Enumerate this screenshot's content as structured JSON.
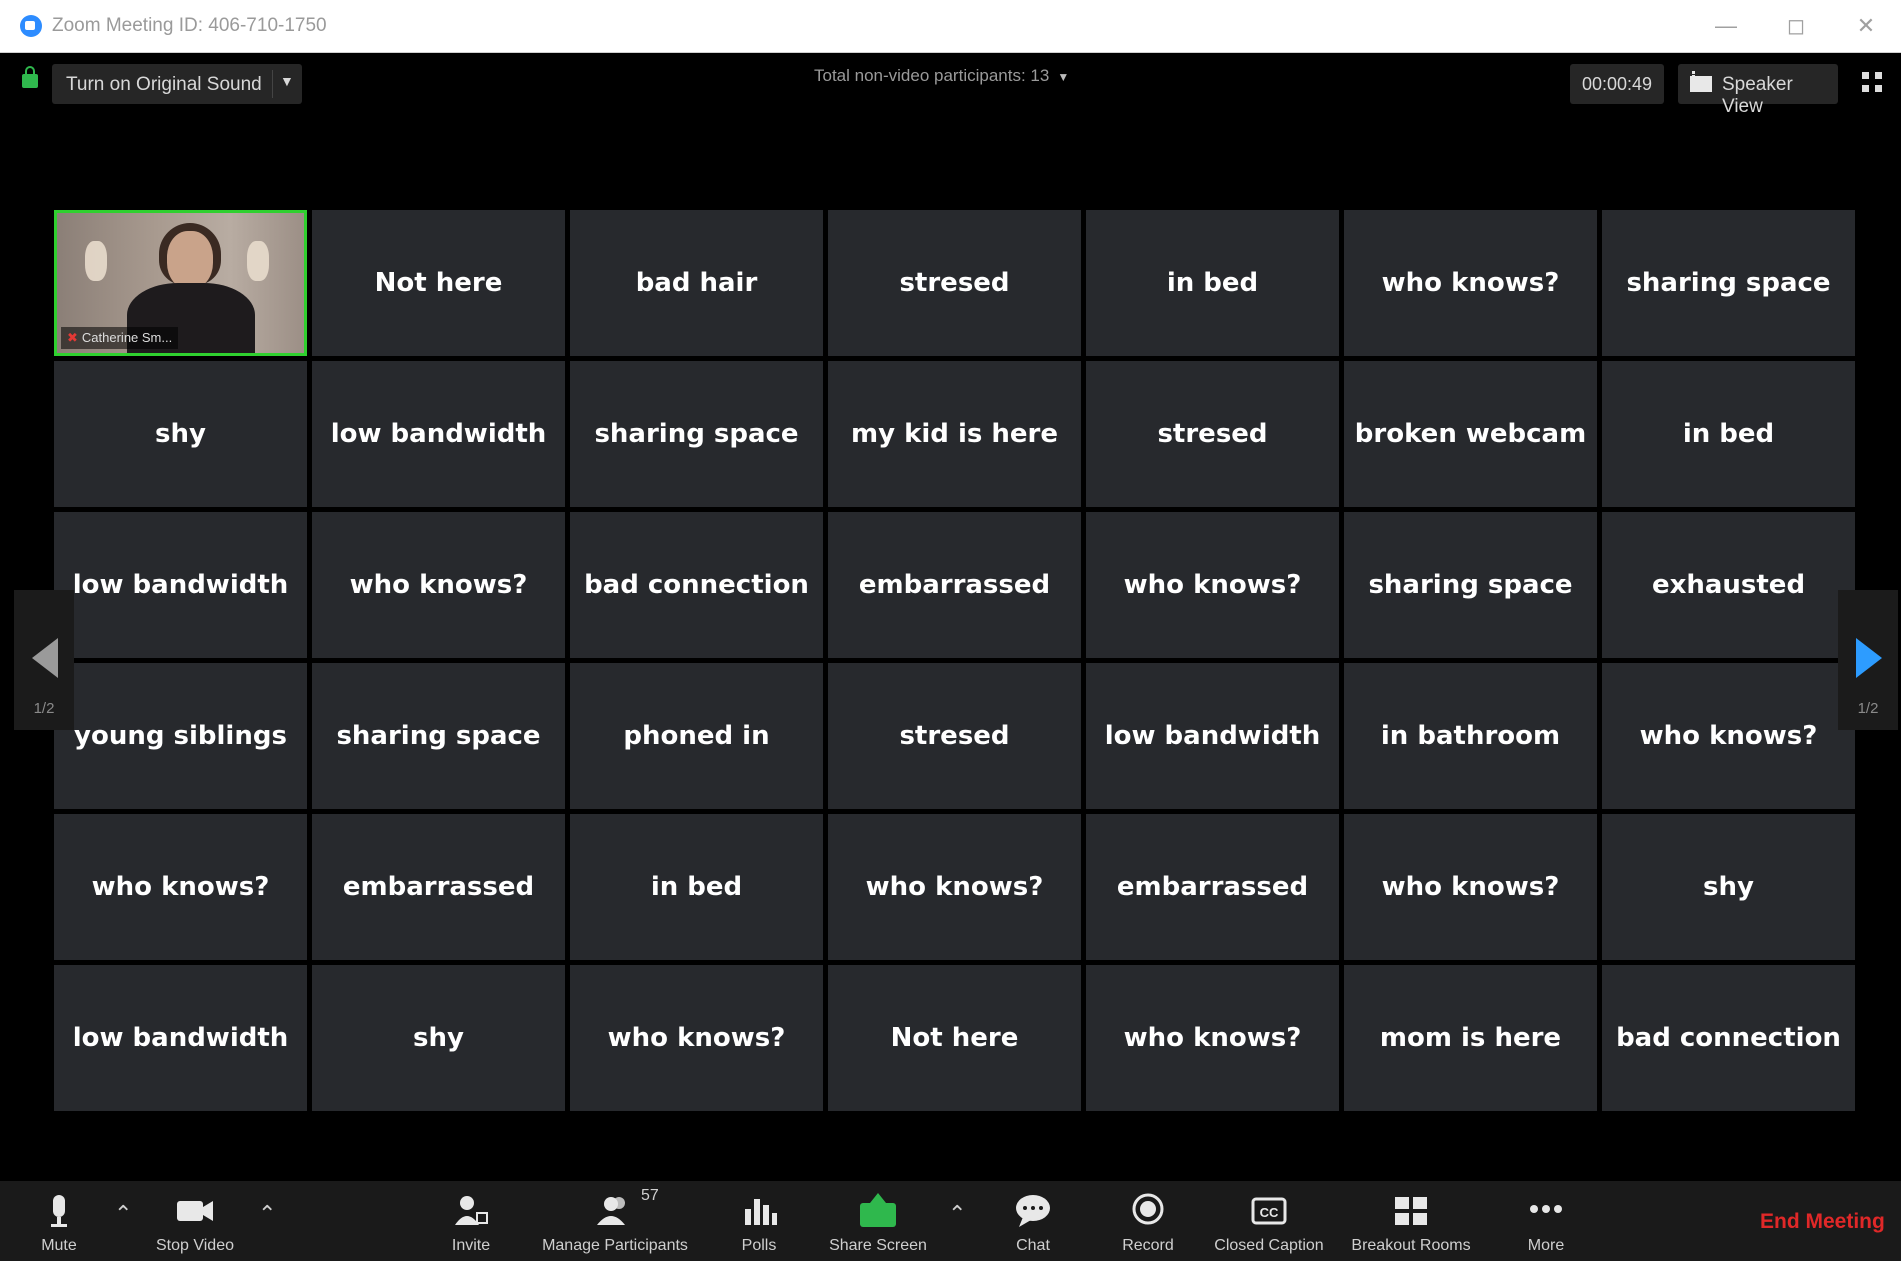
{
  "window": {
    "title": "Zoom Meeting ID: 406-710-1750",
    "controls": [
      "minimize",
      "maximize",
      "close"
    ]
  },
  "topbar": {
    "original_sound_label": "Turn on Original Sound",
    "non_video_label": "Total non-video participants: 13",
    "timer": "00:00:49",
    "view_label": "Speaker View"
  },
  "video_tile": {
    "participant_name": "Catherine Sm..."
  },
  "tiles": [
    "Not here",
    "bad hair",
    "stresed",
    "in bed",
    "who knows?",
    "sharing space",
    "shy",
    "low bandwidth",
    "sharing space",
    "my kid is here",
    "stresed",
    "broken webcam",
    "in bed",
    "low bandwidth",
    "who knows?",
    "bad connection",
    "embarrassed",
    "who knows?",
    "sharing space",
    "exhausted",
    "young siblings",
    "sharing space",
    "phoned in",
    "stresed",
    "low bandwidth",
    "in bathroom",
    "who knows?",
    "who knows?",
    "embarrassed",
    "in bed",
    "who knows?",
    "embarrassed",
    "who knows?",
    "shy",
    "low bandwidth",
    "shy",
    "who knows?",
    "Not here",
    "who knows?",
    "mom is here",
    "bad connection"
  ],
  "pager": {
    "left_label": "1/2",
    "right_label": "1/2"
  },
  "toolbar": {
    "mute": "Mute",
    "stop_video": "Stop Video",
    "invite": "Invite",
    "manage_participants": "Manage Participants",
    "participant_count": "57",
    "polls": "Polls",
    "share_screen": "Share Screen",
    "chat": "Chat",
    "record": "Record",
    "closed_caption": "Closed Caption",
    "breakout_rooms": "Breakout Rooms",
    "more": "More",
    "end_meeting": "End Meeting"
  },
  "colors": {
    "tile_bg": "#27292d",
    "active_speaker_border": "#2fd02f",
    "share_green": "#2fb84d",
    "end_red": "#e02828",
    "pager_blue": "#2d9cff"
  }
}
